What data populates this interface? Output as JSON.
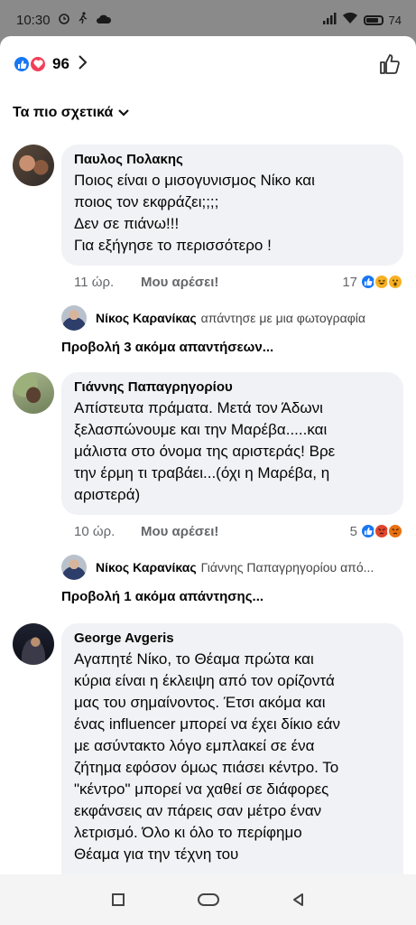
{
  "status_bar": {
    "time": "10:30",
    "battery": "74"
  },
  "header": {
    "reaction_count": "96"
  },
  "sort": {
    "label": "Τα πιο σχετικά"
  },
  "comments": [
    {
      "author": "Παυλος Πολακης",
      "lines": [
        "Ποιος είναι ο μισογυνισμος Νίκο και",
        "ποιος τον εκφράζει;;;;",
        "Δεν σε πιάνω!!!",
        "Για εξήγησε το περισσότερο !"
      ],
      "time": "11 ώρ.",
      "like_label": "Μου αρέσει!",
      "reaction_count": "17",
      "reaction_icons": [
        "like-icon",
        "haha-icon",
        "wow-icon"
      ],
      "reply_preview": {
        "name": "Νίκος Καρανίκας",
        "desc": "απάντησε με μια φωτογραφία"
      },
      "more_replies": "Προβολή 3 ακόμα απαντήσεων..."
    },
    {
      "author": "Γιάννης Παπαγρηγορίου",
      "lines": [
        "Απίστευτα πράματα. Μετά τον Άδωνι",
        "ξελασπώνουμε και την Μαρέβα.....και",
        "μάλιστα στο όνομα της αριστεράς! Βρε",
        "την έρμη τι τραβάει...(όχι η Μαρέβα, η",
        "αριστερά)"
      ],
      "time": "10 ώρ.",
      "like_label": "Μου αρέσει!",
      "reaction_count": "5",
      "reaction_icons": [
        "like-icon",
        "angry-icon",
        "angry-icon"
      ],
      "reply_preview": {
        "name": "Νίκος Καρανίκας",
        "desc": "Γιάννης Παπαγρηγορίου από..."
      },
      "more_replies": "Προβολή 1 ακόμα απάντησης..."
    },
    {
      "author": "George Avgeris",
      "lines": [
        "Αγαπητέ Νίκο, το Θέαμα πρώτα και",
        "κύρια είναι η έκλειψη από τον ορίζοντά",
        "μας του σημαίνοντος. Έτσι ακόμα και",
        "ένας influencer μπορεί να έχει δίκιο εάν",
        "με ασύντακτο λόγο εμπλακεί σε ένα",
        "ζήτημα εφόσον όμως πιάσει κέντρο. Το",
        "\"κέντρο\" μπορεί να χαθεί σε διάφορες",
        "εκφάνσεις αν πάρεις σαν μέτρο έναν",
        "λετρισμό. Όλο κι όλο το περίφημο",
        "Θέαμα για την τέχνη του"
      ]
    }
  ],
  "colors": {
    "like": "#1877f2",
    "love": "#f33e58",
    "haha": "#f7b125",
    "angry": "#e9710f",
    "bubble": "#f0f2f5"
  }
}
